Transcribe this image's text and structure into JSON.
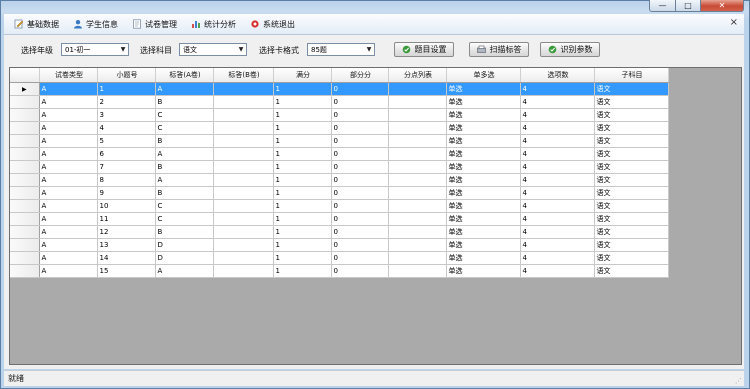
{
  "window": {
    "controls": {
      "minimize": "—",
      "maximize": "□",
      "close": "✕"
    }
  },
  "menu": {
    "items": [
      {
        "label": "基础数据",
        "icon": "edit-icon"
      },
      {
        "label": "学生信息",
        "icon": "user-icon"
      },
      {
        "label": "试卷管理",
        "icon": "document-icon"
      },
      {
        "label": "统计分析",
        "icon": "chart-icon"
      },
      {
        "label": "系统退出",
        "icon": "exit-icon"
      }
    ],
    "close_glyph": "×"
  },
  "toolbar": {
    "grade_label": "选择年级",
    "grade_value": "01-初一",
    "subject_label": "选择科目",
    "subject_value": "语文",
    "card_label": "选择卡格式",
    "card_value": "85题",
    "settings_button": "题目设置",
    "scan_button": "扫描标答",
    "params_button": "识别参数"
  },
  "grid": {
    "columns": [
      "试卷类型",
      "小题号",
      "标答(A卷)",
      "标答(B卷)",
      "满分",
      "部分分",
      "分点列表",
      "单多选",
      "选项数",
      "子科目"
    ],
    "rows": [
      [
        "A",
        "1",
        "A",
        "",
        "1",
        "0",
        "",
        "单选",
        "4",
        "语文"
      ],
      [
        "A",
        "2",
        "B",
        "",
        "1",
        "0",
        "",
        "单选",
        "4",
        "语文"
      ],
      [
        "A",
        "3",
        "C",
        "",
        "1",
        "0",
        "",
        "单选",
        "4",
        "语文"
      ],
      [
        "A",
        "4",
        "C",
        "",
        "1",
        "0",
        "",
        "单选",
        "4",
        "语文"
      ],
      [
        "A",
        "5",
        "B",
        "",
        "1",
        "0",
        "",
        "单选",
        "4",
        "语文"
      ],
      [
        "A",
        "6",
        "A",
        "",
        "1",
        "0",
        "",
        "单选",
        "4",
        "语文"
      ],
      [
        "A",
        "7",
        "B",
        "",
        "1",
        "0",
        "",
        "单选",
        "4",
        "语文"
      ],
      [
        "A",
        "8",
        "A",
        "",
        "1",
        "0",
        "",
        "单选",
        "4",
        "语文"
      ],
      [
        "A",
        "9",
        "B",
        "",
        "1",
        "0",
        "",
        "单选",
        "4",
        "语文"
      ],
      [
        "A",
        "10",
        "C",
        "",
        "1",
        "0",
        "",
        "单选",
        "4",
        "语文"
      ],
      [
        "A",
        "11",
        "C",
        "",
        "1",
        "0",
        "",
        "单选",
        "4",
        "语文"
      ],
      [
        "A",
        "12",
        "B",
        "",
        "1",
        "0",
        "",
        "单选",
        "4",
        "语文"
      ],
      [
        "A",
        "13",
        "D",
        "",
        "1",
        "0",
        "",
        "单选",
        "4",
        "语文"
      ],
      [
        "A",
        "14",
        "D",
        "",
        "1",
        "0",
        "",
        "单选",
        "4",
        "语文"
      ],
      [
        "A",
        "15",
        "A",
        "",
        "1",
        "0",
        "",
        "单选",
        "4",
        "语文"
      ]
    ],
    "selected_row": 0,
    "row_pointer": "▶"
  },
  "status": {
    "text": "就绪"
  },
  "colors": {
    "selection": "#3399ff",
    "grid_background": "#aaaaaa",
    "frame": "#bcd3ec"
  }
}
